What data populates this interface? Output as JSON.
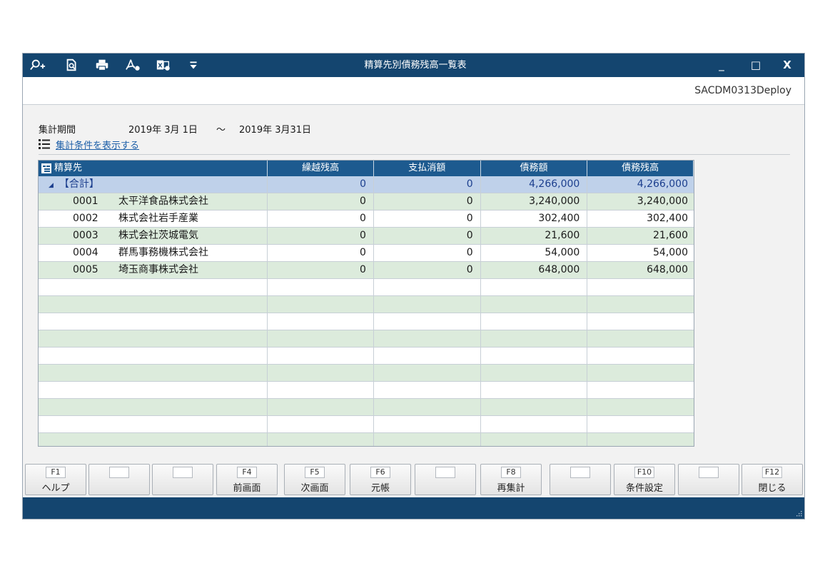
{
  "window": {
    "title": "精算先別債務残高一覧表",
    "program_id": "SACDM0313Deploy",
    "controls": {
      "minimize": "_",
      "maximize": "□",
      "close": "X"
    }
  },
  "toolbar_icons": [
    "zoom-in-icon",
    "preview-icon",
    "print-icon",
    "pdf-icon",
    "excel-icon",
    "dropdown-icon"
  ],
  "period": {
    "label": "集計期間",
    "from": "2019年 3月 1日",
    "separator": "～",
    "to": "2019年 3月31日"
  },
  "conditions_link": "集計条件を表示する",
  "table": {
    "headers": [
      "精算先",
      "繰越残高",
      "支払消額",
      "債務額",
      "債務残高"
    ],
    "total": {
      "label": "【合計】",
      "carryover": "0",
      "payment": "0",
      "debt": "4,266,000",
      "balance": "4,266,000"
    },
    "rows": [
      {
        "code": "0001",
        "name": "太平洋食品株式会社",
        "carryover": "0",
        "payment": "0",
        "debt": "3,240,000",
        "balance": "3,240,000"
      },
      {
        "code": "0002",
        "name": "株式会社岩手産業",
        "carryover": "0",
        "payment": "0",
        "debt": "302,400",
        "balance": "302,400"
      },
      {
        "code": "0003",
        "name": "株式会社茨城電気",
        "carryover": "0",
        "payment": "0",
        "debt": "21,600",
        "balance": "21,600"
      },
      {
        "code": "0004",
        "name": "群馬事務機株式会社",
        "carryover": "0",
        "payment": "0",
        "debt": "54,000",
        "balance": "54,000"
      },
      {
        "code": "0005",
        "name": "埼玉商事株式会社",
        "carryover": "0",
        "payment": "0",
        "debt": "648,000",
        "balance": "648,000"
      }
    ]
  },
  "function_keys": [
    {
      "key": "F1",
      "label": "ヘルプ"
    },
    {
      "key": "",
      "label": ""
    },
    {
      "key": "",
      "label": ""
    },
    {
      "key": "F4",
      "label": "前画面"
    },
    {
      "key": "F5",
      "label": "次画面"
    },
    {
      "key": "F6",
      "label": "元帳"
    },
    {
      "key": "",
      "label": ""
    },
    {
      "key": "F8",
      "label": "再集計"
    },
    {
      "key": "",
      "label": ""
    },
    {
      "key": "F10",
      "label": "条件設定"
    },
    {
      "key": "",
      "label": ""
    },
    {
      "key": "F12",
      "label": "閉じる"
    }
  ],
  "colors": {
    "titlebar": "#14456f",
    "header": "#1d5a8f",
    "total_row": "#bfd1ea",
    "alt_row": "#dcebdc",
    "link": "#1d5fa8"
  }
}
